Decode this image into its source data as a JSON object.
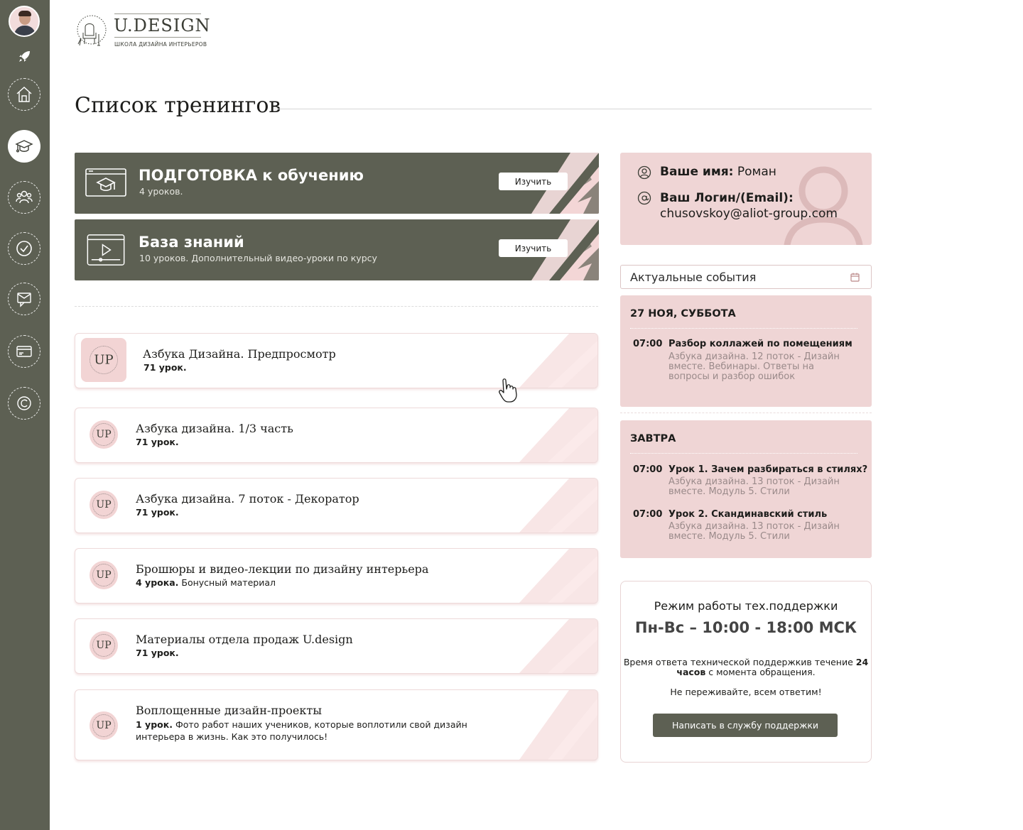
{
  "logo": {
    "title": "U.DESIGN",
    "subtitle": "ШКОЛА ДИЗАЙНА ИНТЕРЬЕРОВ"
  },
  "sidebar": {
    "items": [
      {
        "name": "home",
        "icon": "home-icon"
      },
      {
        "name": "trainings",
        "icon": "graduation-cap-icon",
        "active": true
      },
      {
        "name": "community",
        "icon": "users-icon"
      },
      {
        "name": "tasks",
        "icon": "check-circle-icon"
      },
      {
        "name": "messages",
        "icon": "mail-icon"
      },
      {
        "name": "payments",
        "icon": "credit-card-icon"
      },
      {
        "name": "copyright",
        "icon": "copyright-icon"
      }
    ]
  },
  "page": {
    "title": "Список тренингов"
  },
  "featured": [
    {
      "title": "ПОДГОТОВКА к обучению",
      "subtitle": "4 уроков.",
      "button": "Изучить",
      "icon": "monitor-cap-icon"
    },
    {
      "title": "База знаний",
      "subtitle": "10 уроков. Дополнительный видео-уроки по курсу",
      "button": "Изучить",
      "icon": "video-player-icon"
    }
  ],
  "courses": [
    {
      "title": "Азбука Дизайна. Предпросмотр",
      "lessons": "71 урок.",
      "note": ""
    },
    {
      "title": "Азбука дизайна. 1/3 часть",
      "lessons": "71 урок.",
      "note": ""
    },
    {
      "title": "Азбука дизайна. 7 поток - Декоратор",
      "lessons": "71 урок.",
      "note": ""
    },
    {
      "title": "Брошюры и видео-лекции по дизайну интерьера",
      "lessons": "4 урока.",
      "note": "Бонусный материал"
    },
    {
      "title": "Материалы отдела продаж U.design",
      "lessons": "71 урок.",
      "note": ""
    },
    {
      "title": "Воплощенные дизайн-проекты",
      "lessons": "1 урок.",
      "note": "Фото работ наших учеников, которые воплотили свой дизайн интерьера в жизнь. Как это получилось!"
    }
  ],
  "badge_text": "UP",
  "profile": {
    "name_label": "Ваше имя:",
    "name_value": "Роман",
    "login_label": "Ваш Логин/(Email):",
    "login_value": "chusovskoy@aliot-group.com"
  },
  "events": {
    "select_label": "Актуальные события",
    "days": [
      {
        "day": "27 НОЯ, СУББОТА",
        "items": [
          {
            "time": "07:00",
            "title": "Разбор коллажей по помещениям",
            "desc": "Азбука дизайна. 12 поток - Дизайн вместе. Вебинары. Ответы на вопросы и разбор ошибок"
          }
        ]
      },
      {
        "day": "ЗАВТРА",
        "items": [
          {
            "time": "07:00",
            "title": "Урок 1. Зачем разбираться в стилях?",
            "desc": "Азбука дизайна. 13 поток - Дизайн вместе. Модуль 5. Стили"
          },
          {
            "time": "07:00",
            "title": "Урок 2. Скандинавский стиль",
            "desc": "Азбука дизайна. 13 поток - Дизайн вместе. Модуль 5. Стили"
          }
        ]
      }
    ]
  },
  "support": {
    "title": "Режим работы тех.поддержки",
    "hours": "Пн-Вс – 10:00 - 18:00 МСК",
    "text_before": "Время ответа технической поддержкив течение ",
    "text_bold": "24 часов",
    "text_after": " с момента обращения.",
    "text2": "Не переживайте, всем ответим!",
    "button": "Написать в службу поддержки"
  },
  "colors": {
    "sidebar": "#5d6053",
    "accent_pink": "#efd5d5",
    "dark_card": "#5d6053"
  }
}
